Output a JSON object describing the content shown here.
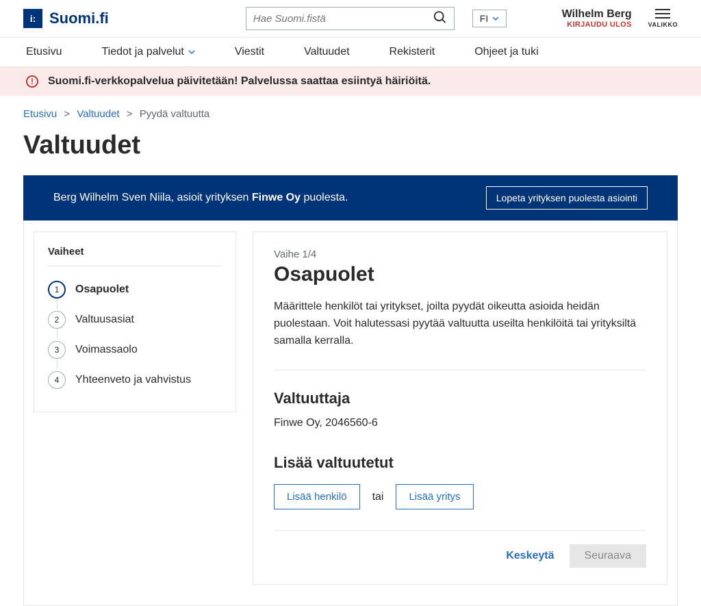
{
  "header": {
    "logo_text": "Suomi.fi",
    "search_placeholder": "Hae Suomi.fistä",
    "language": "FI",
    "user_name": "Wilhelm Berg",
    "logout_label": "KIRJAUDU ULOS",
    "menu_label": "VALIKKO"
  },
  "nav": {
    "home": "Etusivu",
    "info_services": "Tiedot ja palvelut",
    "messages": "Viestit",
    "authorizations": "Valtuudet",
    "registers": "Rekisterit",
    "help": "Ohjeet ja tuki"
  },
  "alert": {
    "text": "Suomi.fi-verkkopalvelua päivitetään! Palvelussa saattaa esiintyä häiriöitä."
  },
  "breadcrumb": {
    "home": "Etusivu",
    "authorizations": "Valtuudet",
    "current": "Pyydä valtuutta"
  },
  "page_title": "Valtuudet",
  "context": {
    "prefix": "Berg Wilhelm Sven Niila, asioit yrityksen ",
    "company": "Finwe Oy",
    "suffix": " puolesta.",
    "end_button": "Lopeta yrityksen puolesta asiointi"
  },
  "steps": {
    "title": "Vaiheet",
    "s1": "Osapuolet",
    "s2": "Valtuusasiat",
    "s3": "Voimassaolo",
    "s4": "Yhteenveto ja vahvistus"
  },
  "main": {
    "stage_label": "Vaihe 1/4",
    "stage_title": "Osapuolet",
    "stage_desc": "Määrittele henkilöt tai yritykset, joilta pyydät oikeutta asioida heidän puolestaan. Voit halutessasi pyytää valtuutta useilta henkilöitä tai yrityksiltä samalla kerralla.",
    "grantor_heading": "Valtuuttaja",
    "grantor_value": "Finwe Oy, 2046560-6",
    "add_heading": "Lisää valtuutetut",
    "add_person": "Lisää henkilö",
    "or": "tai",
    "add_company": "Lisää yritys",
    "cancel": "Keskeytä",
    "next": "Seuraava"
  }
}
